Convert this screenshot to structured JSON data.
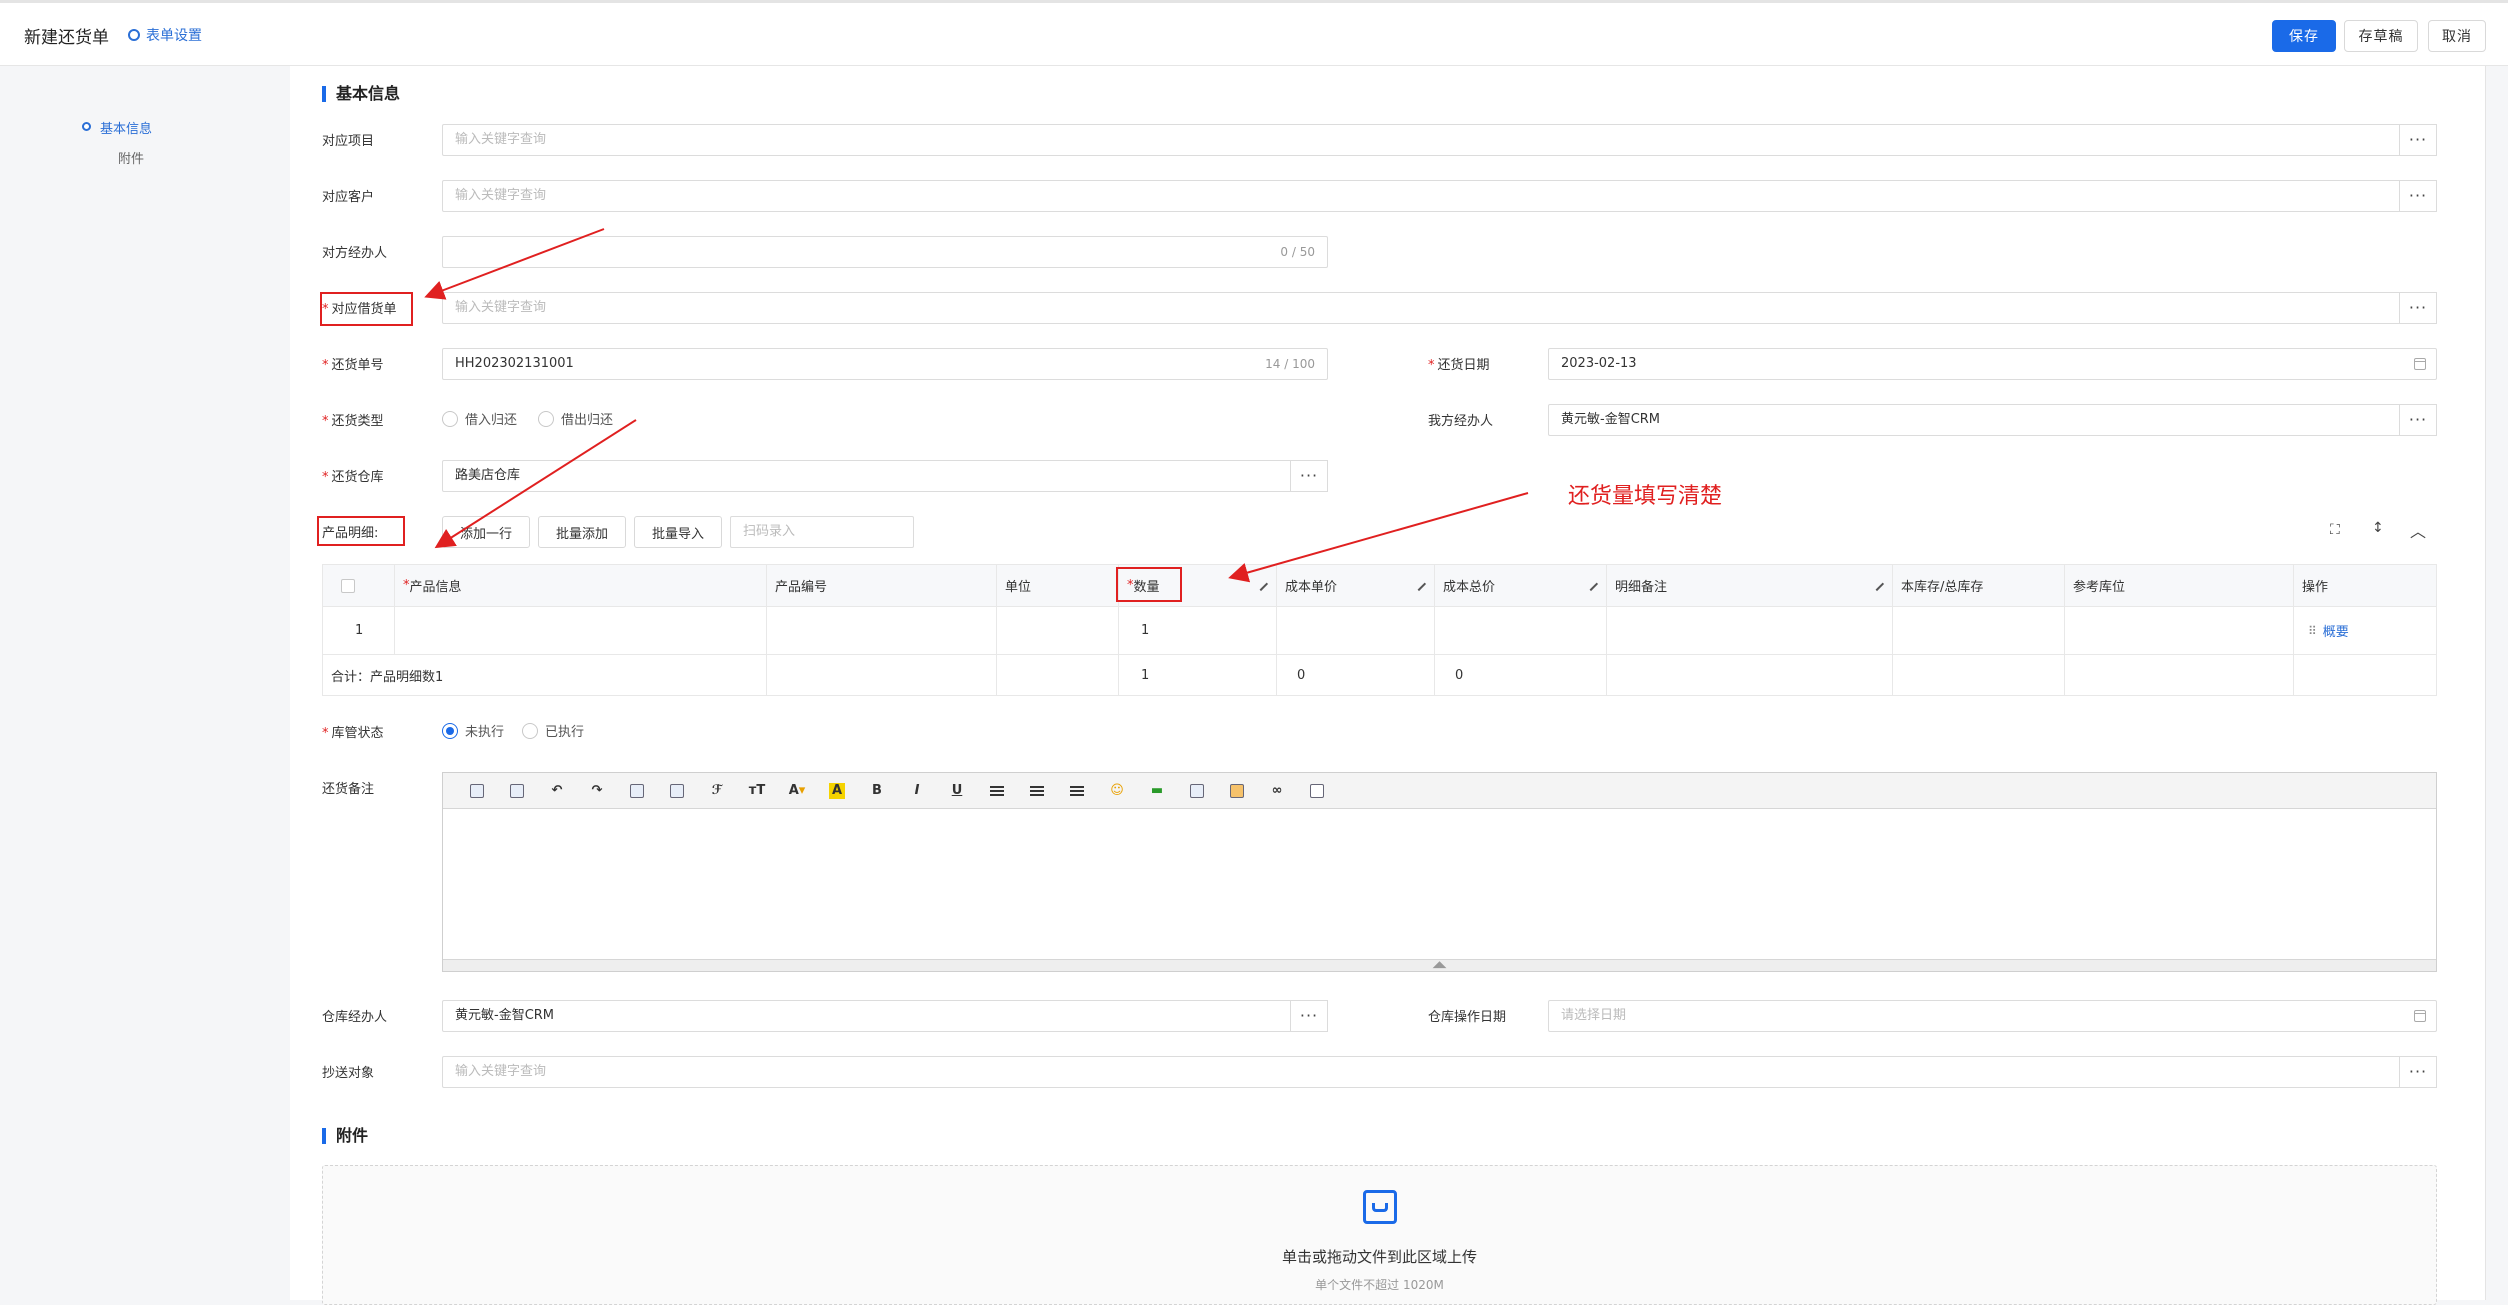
{
  "header": {
    "title": "新建还货单",
    "form_settings": "表单设置",
    "save": "保存",
    "draft": "存草稿",
    "cancel": "取消"
  },
  "sidebar": {
    "items": [
      {
        "label": "基本信息",
        "active": true
      },
      {
        "label": "附件",
        "active": false
      }
    ]
  },
  "sections": {
    "basic": "基本信息",
    "attachment": "附件"
  },
  "fields": {
    "project": {
      "label": "对应项目",
      "placeholder": "输入关键字查询"
    },
    "customer": {
      "label": "对应客户",
      "placeholder": "输入关键字查询"
    },
    "counterpart": {
      "label": "对方经办人",
      "value": "",
      "count": "0 / 50"
    },
    "borrow_order": {
      "label": "对应借货单",
      "placeholder": "输入关键字查询"
    },
    "return_no": {
      "label": "还货单号",
      "value": "HH202302131001",
      "count": "14 / 100"
    },
    "return_date": {
      "label": "还货日期",
      "value": "2023-02-13"
    },
    "return_type": {
      "label": "还货类型",
      "options": [
        "借入归还",
        "借出归还"
      ]
    },
    "our_handler": {
      "label": "我方经办人",
      "value": "黄元敏-金智CRM"
    },
    "warehouse": {
      "label": "还货仓库",
      "value": "路美店仓库"
    },
    "product_detail": {
      "label": "产品明细:",
      "add_row": "添加一行",
      "batch_add": "批量添加",
      "batch_import": "批量导入",
      "scan_placeholder": "扫码录入"
    },
    "stock_status": {
      "label": "库管状态",
      "options": [
        "未执行",
        "已执行"
      ],
      "selected": 0
    },
    "remark": {
      "label": "还货备注"
    },
    "wh_handler": {
      "label": "仓库经办人",
      "value": "黄元敏-金智CRM"
    },
    "wh_date": {
      "label": "仓库操作日期",
      "placeholder": "请选择日期"
    },
    "cc": {
      "label": "抄送对象",
      "placeholder": "输入关键字查询"
    }
  },
  "table": {
    "headers": [
      "产品信息",
      "产品编号",
      "单位",
      "数量",
      "成本单价",
      "成本总价",
      "明细备注",
      "本库存/总库存",
      "参考库位",
      "操作"
    ],
    "row": {
      "index": "1",
      "qty": "1",
      "op": "概要"
    },
    "summary": {
      "label": "合计：产品明细数1",
      "qty": "1",
      "unit_cost": "0",
      "total_cost": "0"
    }
  },
  "upload": {
    "text": "单击或拖动文件到此区域上传",
    "sub": "单个文件不超过 1020M"
  },
  "annotation": {
    "text": "还货量填写清楚",
    "color": "#e02020"
  },
  "accent_color": "#1a6ae8"
}
